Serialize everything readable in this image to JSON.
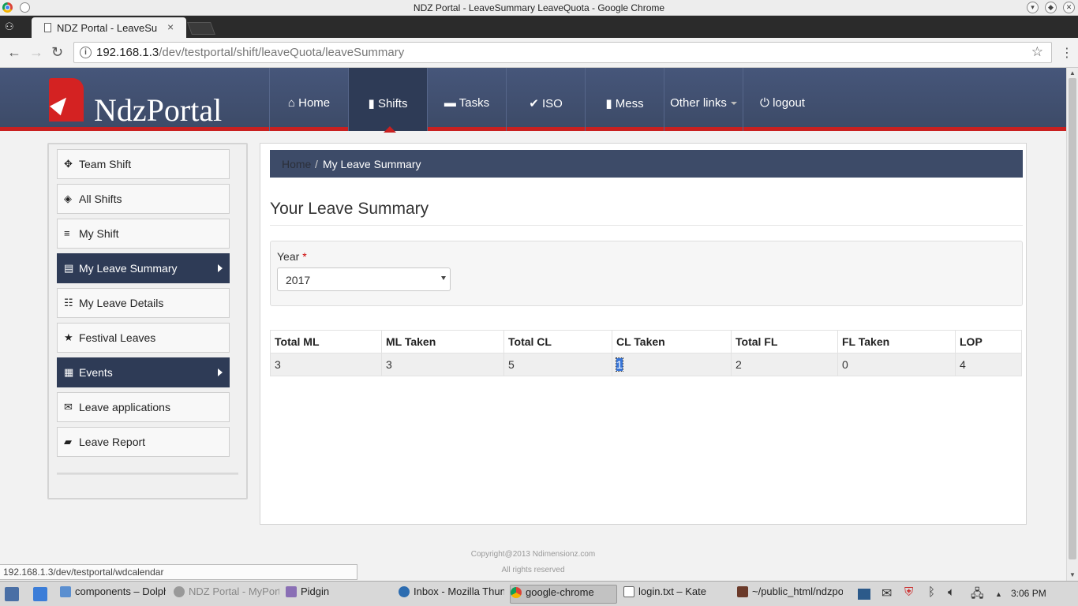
{
  "window": {
    "title": "NDZ Portal - LeaveSummary LeaveQuota - Google Chrome"
  },
  "browser": {
    "tab_title": "NDZ Portal - LeaveSummary LeaveQuota",
    "url_host": "192.168.1.3",
    "url_path": "/dev/testportal/shift/leaveQuota/leaveSummary",
    "status_url": "192.168.1.3/dev/testportal/wdcalendar"
  },
  "header": {
    "logo_text": "NdzPortal",
    "nav": [
      {
        "icon": "⌂",
        "label": "Home"
      },
      {
        "icon": "▮",
        "label": "Shifts"
      },
      {
        "icon": "▬",
        "label": "Tasks"
      },
      {
        "icon": "✔",
        "label": "ISO"
      },
      {
        "icon": "▮",
        "label": "Mess"
      },
      {
        "icon": "",
        "label": "Other links"
      },
      {
        "icon": "⏻",
        "label": "logout"
      }
    ],
    "active_nav": "Shifts"
  },
  "sidebar": {
    "items": [
      {
        "icon": "✥",
        "label": "Team Shift"
      },
      {
        "icon": "◈",
        "label": "All Shifts"
      },
      {
        "icon": "≡",
        "label": "My Shift"
      },
      {
        "icon": "▤",
        "label": "My Leave Summary"
      },
      {
        "icon": "☷",
        "label": "My Leave Details"
      },
      {
        "icon": "★",
        "label": "Festival Leaves"
      },
      {
        "icon": "▦",
        "label": "Events"
      },
      {
        "icon": "✉",
        "label": "Leave applications"
      },
      {
        "icon": "▰",
        "label": "Leave Report"
      }
    ]
  },
  "breadcrumb": {
    "home": "Home",
    "separator": "/",
    "current": "My Leave Summary"
  },
  "main": {
    "title": "Your Leave Summary",
    "year_label": "Year",
    "required_mark": "*",
    "year_value": "2017",
    "table": {
      "headers": [
        "Total ML",
        "ML Taken",
        "Total CL",
        "CL Taken",
        "Total FL",
        "FL Taken",
        "LOP"
      ],
      "row": [
        "3",
        "3",
        "5",
        "1",
        "2",
        "0",
        "4"
      ]
    }
  },
  "footer": {
    "copyright": "Copyright@2013 Ndimensionz.com",
    "rights": "All rights reserved"
  },
  "taskbar": {
    "tasks": [
      "components – Dolphin",
      "NDZ Portal - MyPortal",
      "Pidgin",
      "Inbox - Mozilla Thunderbird",
      "google-chrome",
      "login.txt – Kate",
      "~/public_html/ndzportal"
    ],
    "clock": "3:06 PM"
  },
  "colors": {
    "header_bg": "#435270",
    "accent_red": "#c92020",
    "dark_item": "#2e3b56",
    "selection": "#3875d7"
  }
}
